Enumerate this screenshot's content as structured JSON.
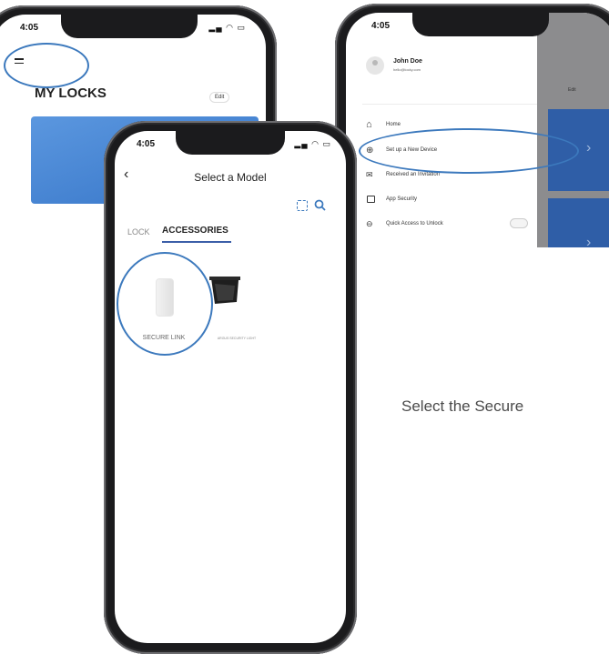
{
  "phone_left": {
    "time": "4:05",
    "title": "MY LOCKS",
    "edit_label": "Edit"
  },
  "phone_right": {
    "time": "4:05",
    "user_name": "John Doe",
    "user_email": "hello@locky.com",
    "edit_label": "Edit",
    "menu": [
      {
        "label": "Home",
        "icon": "home-icon"
      },
      {
        "label": "Set up a New Device",
        "icon": "plus-circle-icon"
      },
      {
        "label": "Received an Invitation",
        "icon": "mail-icon"
      },
      {
        "label": "App Security",
        "icon": "lock-icon"
      },
      {
        "label": "Quick Access to Unlock",
        "icon": "unlock-icon"
      }
    ]
  },
  "phone_center": {
    "time": "4:05",
    "title": "Select a Model",
    "tabs": [
      {
        "label": "LOCK",
        "active": false
      },
      {
        "label": "ACCESSORIES",
        "active": true
      }
    ],
    "products": [
      {
        "label": "SECURE LINK"
      },
      {
        "label": "ARGUS SECURITY LIGHT"
      }
    ]
  },
  "instruction": "Select the Secure",
  "colors": {
    "accent": "#3c79bd",
    "card_blue": "#3f80cf",
    "tab_underline": "#3c5fa8"
  }
}
